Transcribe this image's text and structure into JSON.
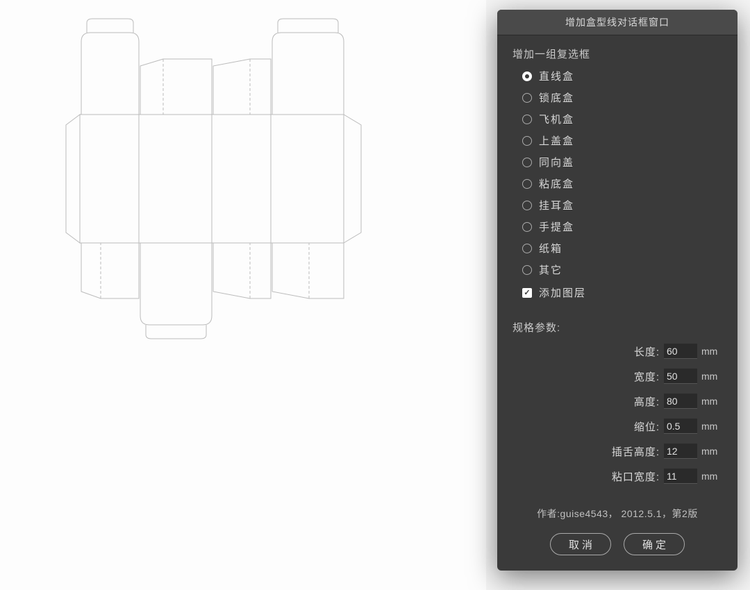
{
  "dialog": {
    "title": "增加盒型线对话框窗口",
    "group_label": "增加一组复选框",
    "box_types": [
      {
        "key": "straight",
        "label": "直线盒",
        "selected": true
      },
      {
        "key": "lockbottom",
        "label": "锁底盒",
        "selected": false
      },
      {
        "key": "airplane",
        "label": "飞机盒",
        "selected": false
      },
      {
        "key": "toplid",
        "label": "上盖盒",
        "selected": false
      },
      {
        "key": "sameface",
        "label": "同向盖",
        "selected": false
      },
      {
        "key": "gluebottom",
        "label": "粘底盒",
        "selected": false
      },
      {
        "key": "earhang",
        "label": "挂耳盒",
        "selected": false
      },
      {
        "key": "handle",
        "label": "手提盒",
        "selected": false
      },
      {
        "key": "carton",
        "label": "纸箱",
        "selected": false
      },
      {
        "key": "other",
        "label": "其它",
        "selected": false
      }
    ],
    "add_layer": {
      "label": "添加图层",
      "checked": true,
      "checkmark": "✓"
    },
    "params_label": "规格参数:",
    "params": [
      {
        "key": "length",
        "label": "长度:",
        "value": "60",
        "unit": "mm"
      },
      {
        "key": "width",
        "label": "宽度:",
        "value": "50",
        "unit": "mm"
      },
      {
        "key": "height",
        "label": "高度:",
        "value": "80",
        "unit": "mm"
      },
      {
        "key": "shrink",
        "label": "缩位:",
        "value": "0.5",
        "unit": "mm"
      },
      {
        "key": "tongue",
        "label": "插舌高度:",
        "value": "12",
        "unit": "mm"
      },
      {
        "key": "gluewidth",
        "label": "粘口宽度:",
        "value": "11",
        "unit": "mm"
      }
    ],
    "author_line": "作者:guise4543， 2012.5.1，第2版",
    "cancel_label": "取消",
    "ok_label": "确定"
  }
}
